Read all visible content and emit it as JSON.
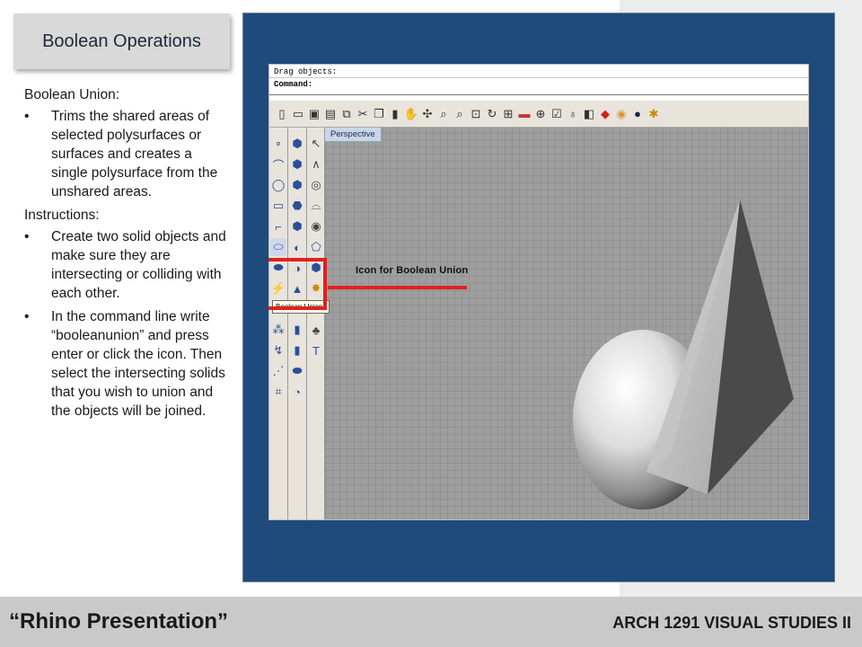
{
  "slide": {
    "title": "Boolean Operations",
    "intro_heading": "Boolean Union:",
    "intro_bullets": [
      "Trims the shared areas of selected polysurfaces or surfaces and creates a single polysurface from the unshared areas."
    ],
    "instructions_heading": "Instructions:",
    "instruction_bullets": [
      "Create two solid objects and make sure they are intersecting or colliding with each other.",
      "In the command line write “booleanunion” and press enter or click the icon. Then select the intersecting solids that you wish to union and the objects will be joined."
    ]
  },
  "rhino": {
    "command_history": "Drag objects:",
    "command_prompt": "Command:",
    "viewport_label": "Perspective",
    "tooltip": "Boolean Union",
    "annotation": "Icon for Boolean Union",
    "top_toolbar_icons": [
      "new-icon",
      "open-icon",
      "save-icon",
      "print-icon",
      "import-icon",
      "cut-icon",
      "copy-icon",
      "paste-icon",
      "pan-icon",
      "move-icon",
      "zoom-icon",
      "zoom-window-icon",
      "zoom-extents-icon",
      "rotate-view-icon",
      "grid-icon",
      "car-icon",
      "snap-icon",
      "check-icon",
      "lightbulb-icon",
      "shade-icon",
      "render-icon",
      "material-icon",
      "sphere-render-icon",
      "settings-icon"
    ],
    "left_toolbar_col1_icons": [
      "point-icon",
      "curve-icon",
      "circle-icon",
      "rectangle-icon",
      "fillet-icon",
      "boolean-union-icon",
      "boolean-difference-icon",
      "array-icon",
      "trim-icon",
      "group-icon",
      "join-icon",
      "explode-icon",
      "mesh-icon"
    ],
    "left_toolbar_col2_icons": [
      "box-icon",
      "cylinder-icon",
      "cone-icon",
      "pyramid-icon",
      "torus-icon",
      "pipe-icon",
      "extrude-icon",
      "revolve-icon",
      "loft-icon",
      "sweep-icon",
      "sphere-icon",
      "ellipsoid-icon",
      "cap-icon"
    ],
    "left_toolbar_col3_icons": [
      "select-icon",
      "polyline-icon",
      "edit-point-icon",
      "arc-icon",
      "offset-icon",
      "surface-icon",
      "text-icon",
      "dimension-icon",
      "curve-tool-icon",
      "block-icon",
      "cube-icon"
    ],
    "colors": {
      "frame_blue": "#1f4a7c",
      "annotation_red": "#e22020",
      "viewport_gray": "#9e9e9e"
    }
  },
  "footer": {
    "left_title": "“Rhino Presentation”",
    "right_course": "ARCH 1291 VISUAL STUDIES II"
  }
}
